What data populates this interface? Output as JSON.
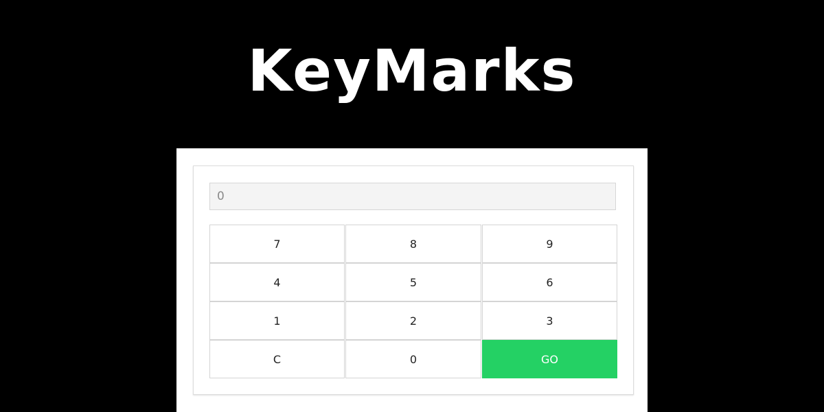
{
  "app": {
    "title": "KeyMarks"
  },
  "display": {
    "value": "0"
  },
  "keypad": {
    "keys": [
      "7",
      "8",
      "9",
      "4",
      "5",
      "6",
      "1",
      "2",
      "3",
      "C",
      "0",
      "GO"
    ]
  },
  "colors": {
    "background": "#000000",
    "go_button": "#24d164",
    "display_bg": "#f4f4f4"
  }
}
